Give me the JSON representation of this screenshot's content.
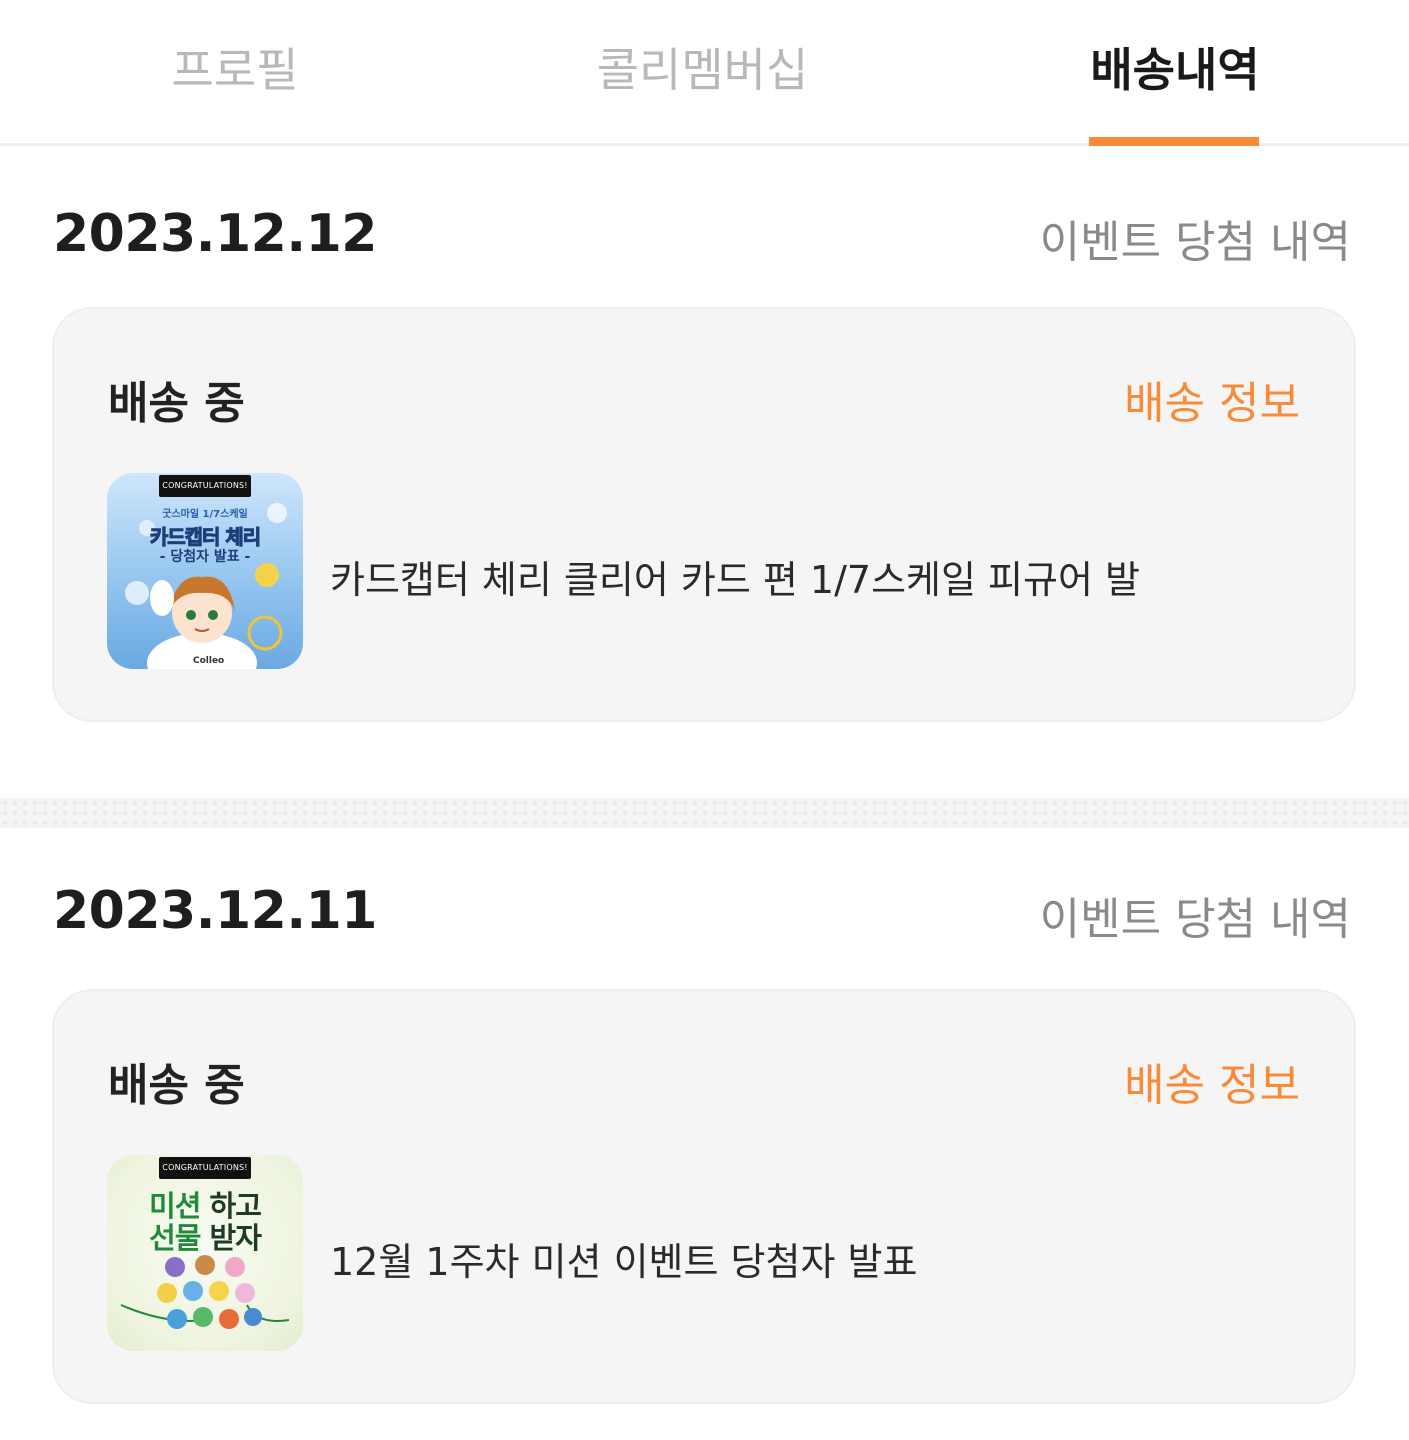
{
  "tabs": {
    "profile": "프로필",
    "membership": "콜리멤버십",
    "delivery": "배송내역"
  },
  "orders": [
    {
      "date": "2023.12.12",
      "event_type": "이벤트 당첨 내역",
      "status": "배송 중",
      "info_link": "배송 정보",
      "thumbnail": {
        "badge": "CONGRATULATIONS!",
        "sub": "굿스마일 1/7스케일",
        "headline": "카드캡터 체리",
        "sub2": "- 당첨자 발표 -"
      },
      "title": "카드캡터 체리 클리어 카드 편 1/7스케일 피규어 발"
    },
    {
      "date": "2023.12.11",
      "event_type": "이벤트 당첨 내역",
      "status": "배송 중",
      "info_link": "배송 정보",
      "thumbnail": {
        "badge": "CONGRATULATIONS!",
        "line1a": "미션",
        "line1b": "하고",
        "line2a": "선물",
        "line2b": "받자"
      },
      "title": "12월 1주차 미션 이벤트 당첨자 발표"
    }
  ],
  "colors": {
    "accent": "#f98a37",
    "card_bg": "#f5f5f5",
    "inactive_tab": "#b8b8b8",
    "muted_text": "#8a8a8a"
  }
}
